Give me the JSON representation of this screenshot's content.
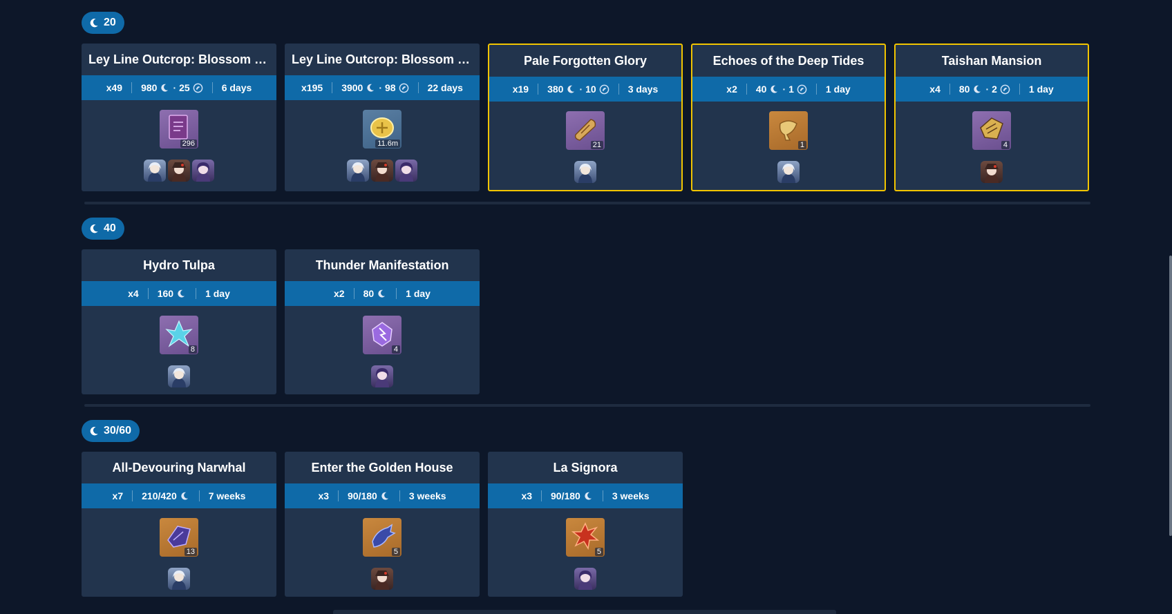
{
  "sections": [
    {
      "badge": "20",
      "cards": [
        {
          "title": "Ley Line Outcrop: Blossom of ...",
          "runs": "x49",
          "resin": "980",
          "fragile": "25",
          "time": "6 days",
          "item_count": "296",
          "item_bg": "purple",
          "item_icon": "book-icon",
          "chars": [
            "furina",
            "hutao",
            "raiden"
          ],
          "highlight": false
        },
        {
          "title": "Ley Line Outcrop: Blossom of ...",
          "runs": "x195",
          "resin": "3900",
          "fragile": "98",
          "time": "22 days",
          "item_count": "11.6m",
          "item_bg": "blue",
          "item_icon": "mora-coin-icon",
          "chars": [
            "furina",
            "hutao",
            "raiden"
          ],
          "highlight": false
        },
        {
          "title": "Pale Forgotten Glory",
          "runs": "x19",
          "resin": "380",
          "fragile": "10",
          "time": "3 days",
          "item_count": "21",
          "item_bg": "purple",
          "item_icon": "scroll-icon",
          "chars": [
            "furina"
          ],
          "highlight": true
        },
        {
          "title": "Echoes of the Deep Tides",
          "runs": "x2",
          "resin": "40",
          "fragile": "1",
          "time": "1 day",
          "item_count": "1",
          "item_bg": "orange",
          "item_icon": "conch-icon",
          "chars": [
            "furina"
          ],
          "highlight": true
        },
        {
          "title": "Taishan Mansion",
          "runs": "x4",
          "resin": "80",
          "fragile": "2",
          "time": "1 day",
          "item_count": "4",
          "item_bg": "purple",
          "item_icon": "gold-fragment-icon",
          "chars": [
            "hutao"
          ],
          "highlight": true
        }
      ]
    },
    {
      "badge": "40",
      "cards": [
        {
          "title": "Hydro Tulpa",
          "runs": "x4",
          "resin": "160",
          "fragile": null,
          "time": "1 day",
          "item_count": "8",
          "item_bg": "purple",
          "item_icon": "water-crystal-icon",
          "chars": [
            "furina"
          ],
          "highlight": false
        },
        {
          "title": "Thunder Manifestation",
          "runs": "x2",
          "resin": "80",
          "fragile": null,
          "time": "1 day",
          "item_count": "4",
          "item_bg": "purple",
          "item_icon": "thunder-crystal-icon",
          "chars": [
            "raiden"
          ],
          "highlight": false
        }
      ]
    },
    {
      "badge": "30/60",
      "cards": [
        {
          "title": "All-Devouring Narwhal",
          "runs": "x7",
          "resin": "210/420",
          "fragile": null,
          "time": "7 weeks",
          "item_count": "13",
          "item_bg": "orange",
          "item_icon": "dark-fin-icon",
          "chars": [
            "furina"
          ],
          "highlight": false
        },
        {
          "title": "Enter the Golden House",
          "runs": "x3",
          "resin": "90/180",
          "fragile": null,
          "time": "3 weeks",
          "item_count": "5",
          "item_bg": "orange",
          "item_icon": "spiked-gauntlet-icon",
          "chars": [
            "hutao"
          ],
          "highlight": false
        },
        {
          "title": "La Signora",
          "runs": "x3",
          "resin": "90/180",
          "fragile": null,
          "time": "3 weeks",
          "item_count": "5",
          "item_bg": "orange",
          "item_icon": "ashen-heart-icon",
          "chars": [
            "raiden"
          ],
          "highlight": false
        }
      ]
    }
  ],
  "colors": {
    "accent": "#0f6aa8",
    "highlight": "#f2c500",
    "card": "#22344d",
    "background": "#0d1729"
  }
}
